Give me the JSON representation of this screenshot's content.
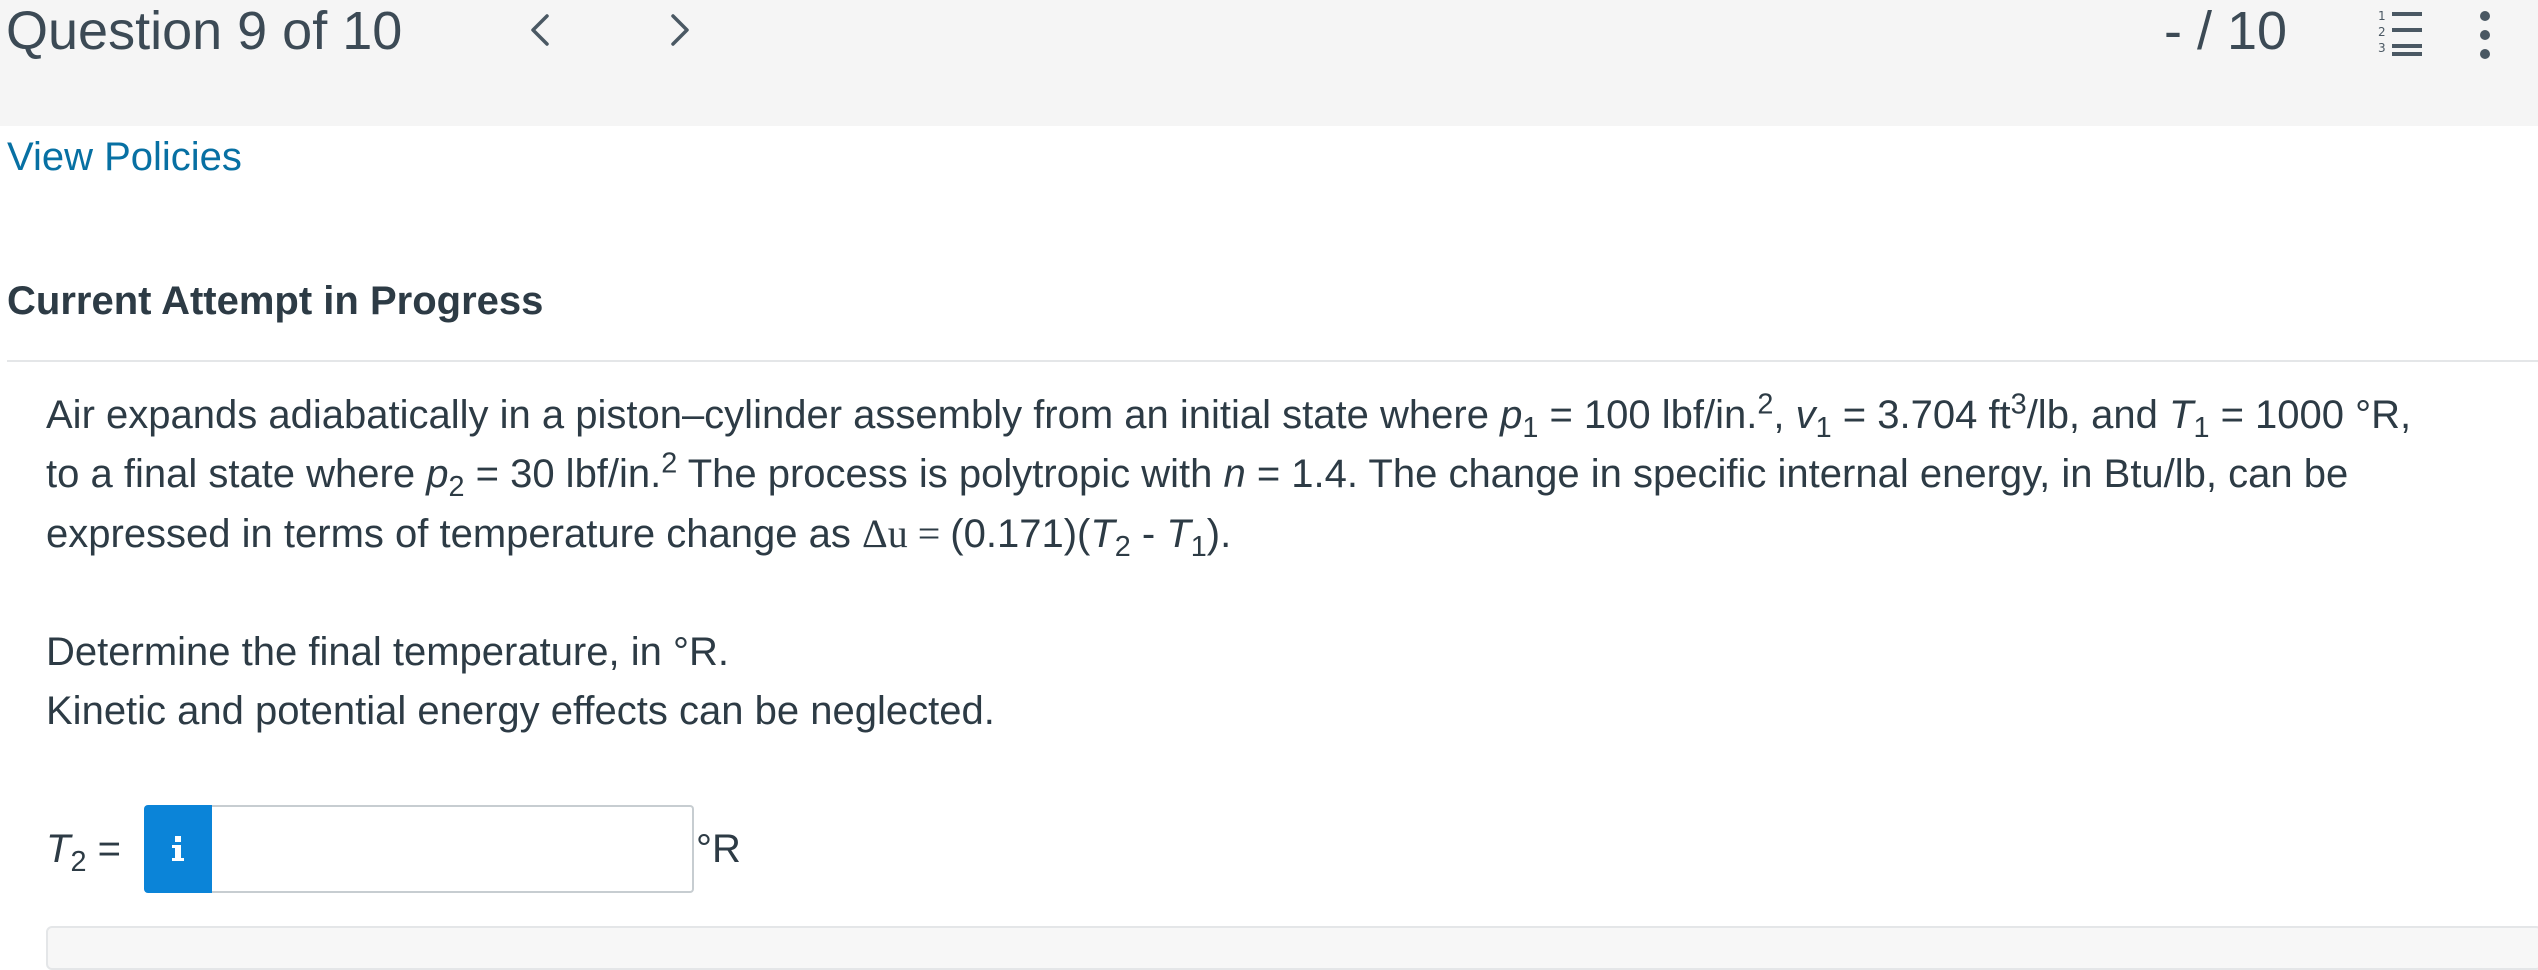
{
  "header": {
    "question_counter": "Question 9 of 10",
    "score": "- / 10",
    "icons": {
      "prev": "chevron-left-icon",
      "next": "chevron-right-icon",
      "list": "numbered-list-icon",
      "more": "more-vertical-icon"
    }
  },
  "policies_link": "View Policies",
  "attempt_heading": "Current Attempt in Progress",
  "problem": {
    "line1": {
      "a": "Air expands adiabatically in a piston–cylinder assembly from an initial state where ",
      "p1_sym": "p",
      "p1_sub": "1",
      "p1_val": " = 100 lbf/in.",
      "p1_sup": "2",
      "v1_lead": ", ",
      "v1_sym": "v",
      "v1_sub": "1",
      "v1_val": " = 3.704 ft",
      "v1_sup": "3",
      "v1_tail": "/lb, and ",
      "t1_sym": "T",
      "t1_sub": "1",
      "t1_val": " = 1000 °R,"
    },
    "line2": {
      "a": "to a final state where ",
      "p2_sym": "p",
      "p2_sub": "2",
      "p2_val": " = 30 lbf/in.",
      "p2_sup": "2",
      "b": " The process is polytropic with ",
      "n_sym": "n",
      "c": " = 1.4. The change in specific internal energy, in Btu/lb, can be"
    },
    "line3": {
      "a": "expressed in terms of temperature change as ",
      "du": "Δu",
      "eq": " = ",
      "coef": " (0.171)(",
      "t2_sym": "T",
      "t2_sub": "2",
      "minus": " - ",
      "t1_sym": "T",
      "t1_sub": "1",
      "close": ")."
    },
    "task": "Determine the final temperature, in °R.",
    "note": "Kinetic and potential energy effects can be neglected."
  },
  "answer": {
    "label_sym": "T",
    "label_sub": "2",
    "label_eq": " =",
    "info_icon": "info-icon",
    "value": "",
    "unit": "°R"
  },
  "colors": {
    "link": "#0770a3",
    "info_button": "#0b84d8",
    "header_bg": "#f5f5f5",
    "text": "#2d3b45"
  }
}
